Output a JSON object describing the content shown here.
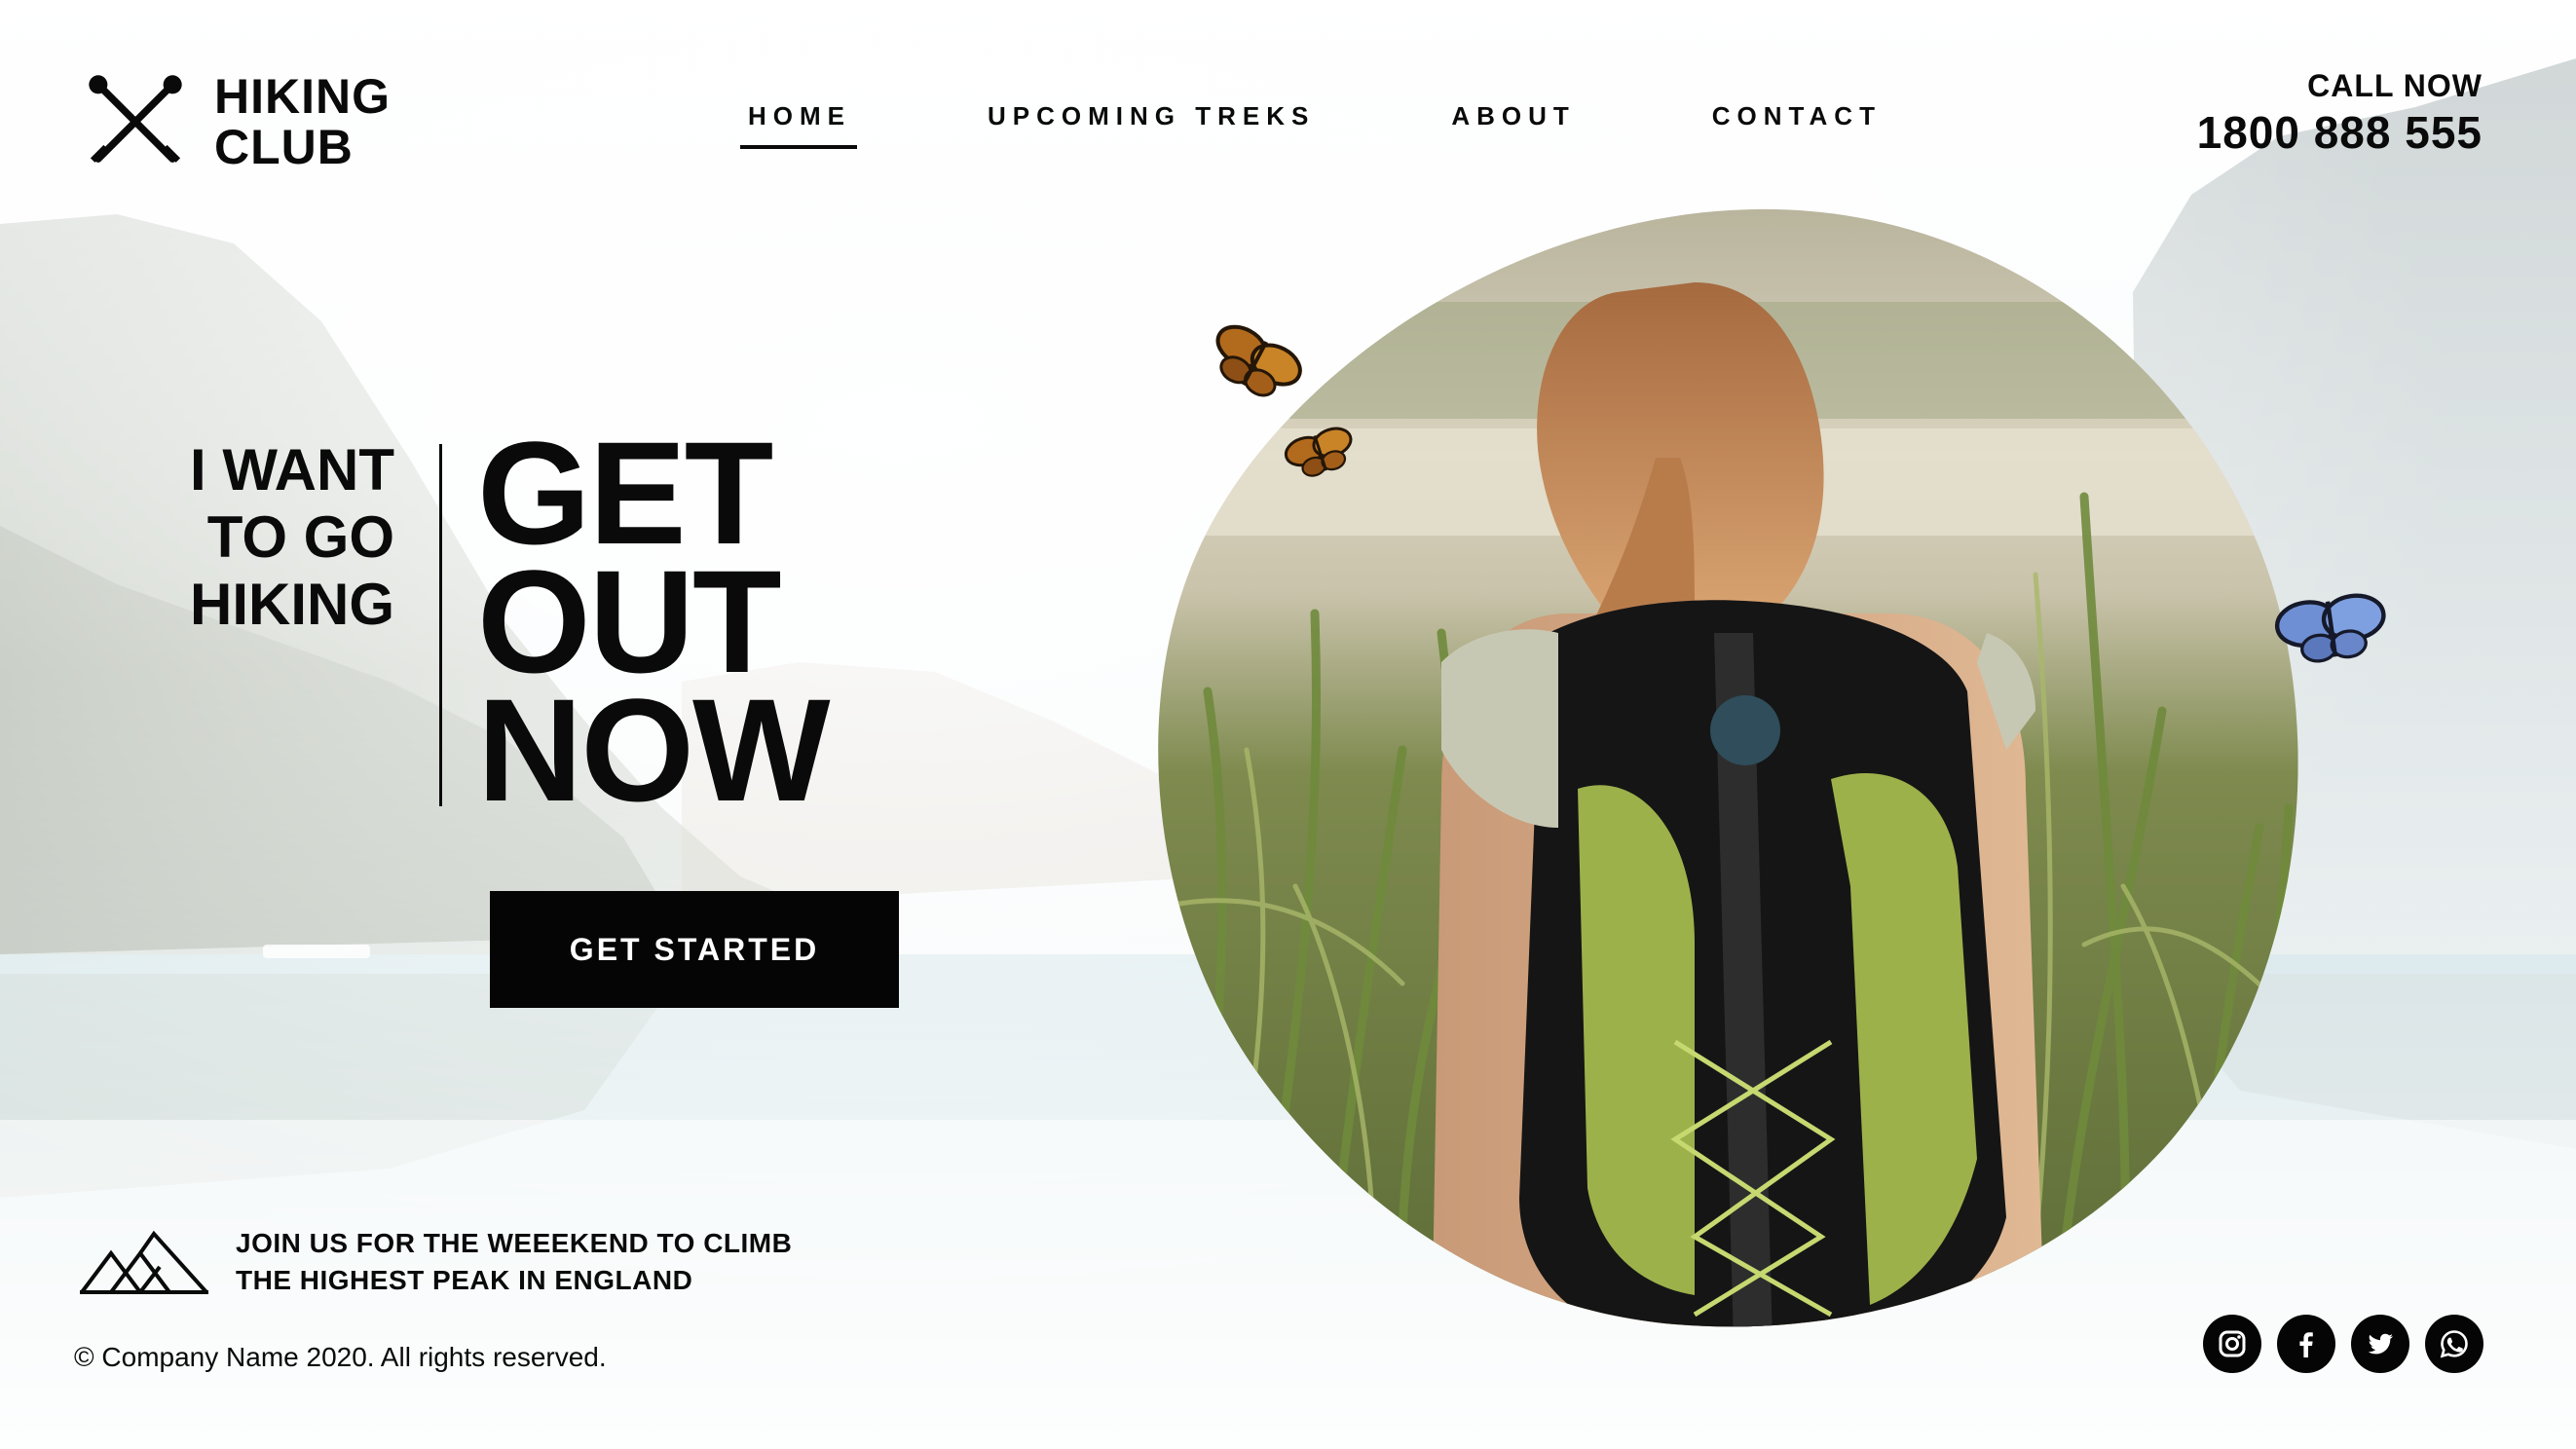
{
  "brand": {
    "name": "HIKING CLUB",
    "icon": "crossed-trekking-poles-icon"
  },
  "nav": {
    "items": [
      {
        "label": "HOME",
        "active": true
      },
      {
        "label": "UPCOMING TREKS",
        "active": false
      },
      {
        "label": "ABOUT",
        "active": false
      },
      {
        "label": "CONTACT",
        "active": false
      }
    ]
  },
  "contact": {
    "label": "CALL NOW",
    "phone": "1800 888 555"
  },
  "hero": {
    "kicker": "I WANT\nTO GO\nHIKING",
    "headline": "GET\nOUT\nNOW",
    "cta_label": "GET STARTED",
    "image": "woman-hiker-with-backpack-in-tall-grass"
  },
  "promo": {
    "icon": "mountains-icon",
    "text": "JOIN US FOR THE WEEEKEND TO CLIMB THE HIGHEST PEAK IN ENGLAND"
  },
  "footer": {
    "copyright": "© Company Name 2020. All rights reserved."
  },
  "social": [
    {
      "name": "instagram-icon"
    },
    {
      "name": "facebook-icon"
    },
    {
      "name": "twitter-icon"
    },
    {
      "name": "whatsapp-icon"
    }
  ],
  "colors": {
    "text": "#0a0a0a",
    "button": "#050505",
    "button_text": "#ffffff"
  }
}
